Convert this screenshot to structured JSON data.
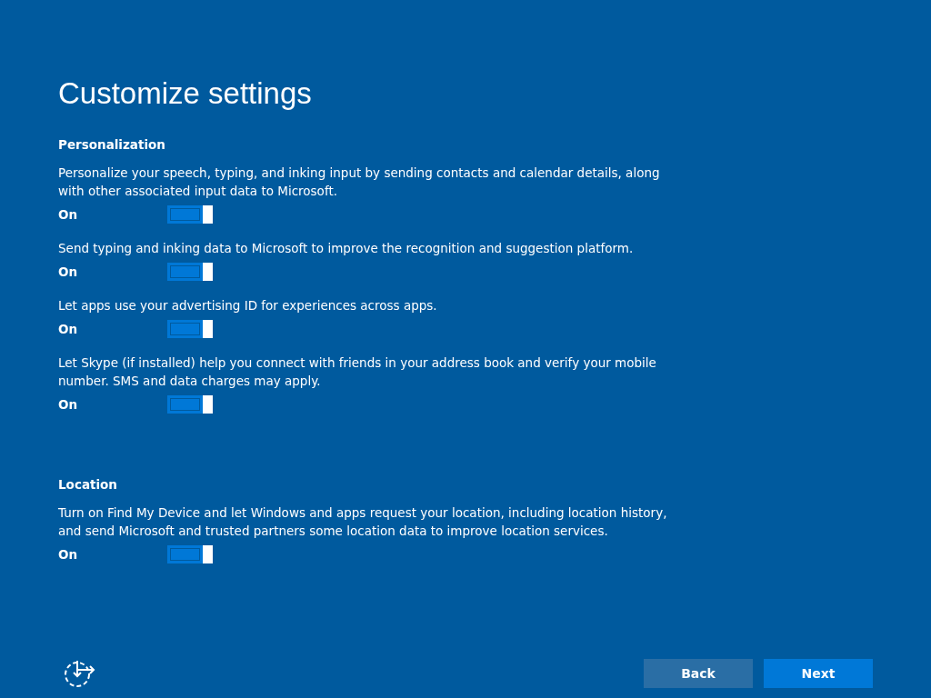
{
  "title": "Customize settings",
  "sections": [
    {
      "heading": "Personalization",
      "items": [
        {
          "text": "Personalize your speech, typing, and inking input by sending contacts and calendar details, along with other associated input data to Microsoft.",
          "state_label": "On",
          "on": true
        },
        {
          "text": "Send typing and inking data to Microsoft to improve the recognition and suggestion platform.",
          "state_label": "On",
          "on": true
        },
        {
          "text": "Let apps use your advertising ID for experiences across apps.",
          "state_label": "On",
          "on": true
        },
        {
          "text": "Let Skype (if installed) help you connect with friends in your address book and verify your mobile number. SMS and data charges may apply.",
          "state_label": "On",
          "on": true
        }
      ]
    },
    {
      "heading": "Location",
      "items": [
        {
          "text": "Turn on Find My Device and let Windows and apps request your location, including location history, and send Microsoft and trusted partners some location data to improve location services.",
          "state_label": "On",
          "on": true
        }
      ]
    }
  ],
  "buttons": [
    {
      "label": "Back",
      "kind": "secondary"
    },
    {
      "label": "Next",
      "kind": "primary"
    }
  ]
}
